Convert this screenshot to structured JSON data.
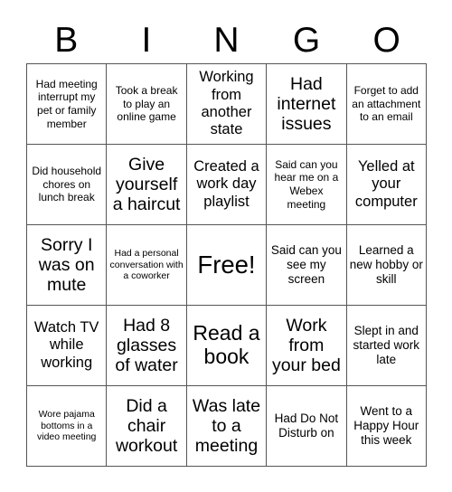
{
  "card": {
    "type": "bingo-card",
    "columns": 5,
    "rows": 5,
    "header_letters": [
      "B",
      "I",
      "N",
      "G",
      "O"
    ],
    "free_space_label": "Free!",
    "free_space_position": {
      "row": 3,
      "column": 3
    },
    "colors": {
      "background": "#ffffff",
      "text": "#000000",
      "grid_line": "#555555"
    },
    "cells": [
      {
        "text": "Had meeting interrupt my pet or family member",
        "size": "s",
        "free": false
      },
      {
        "text": "Took a break to play an online game",
        "size": "s",
        "free": false
      },
      {
        "text": "Working from another state",
        "size": "l",
        "free": false
      },
      {
        "text": "Had internet issues",
        "size": "xl",
        "free": false
      },
      {
        "text": "Forget to add an attachment to an email",
        "size": "s",
        "free": false
      },
      {
        "text": "Did household chores on lunch break",
        "size": "s",
        "free": false
      },
      {
        "text": "Give yourself a haircut",
        "size": "xl",
        "free": false
      },
      {
        "text": "Created a work day playlist",
        "size": "l",
        "free": false
      },
      {
        "text": "Said can you hear me on a Webex meeting",
        "size": "s",
        "free": false
      },
      {
        "text": "Yelled at your computer",
        "size": "l",
        "free": false
      },
      {
        "text": "Sorry I was on mute",
        "size": "xl",
        "free": false
      },
      {
        "text": "Had a personal conversation with a coworker",
        "size": "xs",
        "free": false
      },
      {
        "text": "Free!",
        "size": "free",
        "free": true
      },
      {
        "text": "Said can you see my screen",
        "size": "m",
        "free": false
      },
      {
        "text": "Learned a new hobby or skill",
        "size": "m",
        "free": false
      },
      {
        "text": "Watch TV while working",
        "size": "l",
        "free": false
      },
      {
        "text": "Had 8 glasses of water",
        "size": "xl",
        "free": false
      },
      {
        "text": "Read a book",
        "size": "xxl",
        "free": false
      },
      {
        "text": "Work from your bed",
        "size": "xl",
        "free": false
      },
      {
        "text": "Slept in and started work late",
        "size": "m",
        "free": false
      },
      {
        "text": "Wore pajama bottoms in a video meeting",
        "size": "xs",
        "free": false
      },
      {
        "text": "Did a chair workout",
        "size": "xl",
        "free": false
      },
      {
        "text": "Was late to a meeting",
        "size": "xl",
        "free": false
      },
      {
        "text": "Had Do Not Disturb on",
        "size": "m",
        "free": false
      },
      {
        "text": "Went to a Happy Hour this week",
        "size": "m",
        "free": false
      }
    ]
  }
}
